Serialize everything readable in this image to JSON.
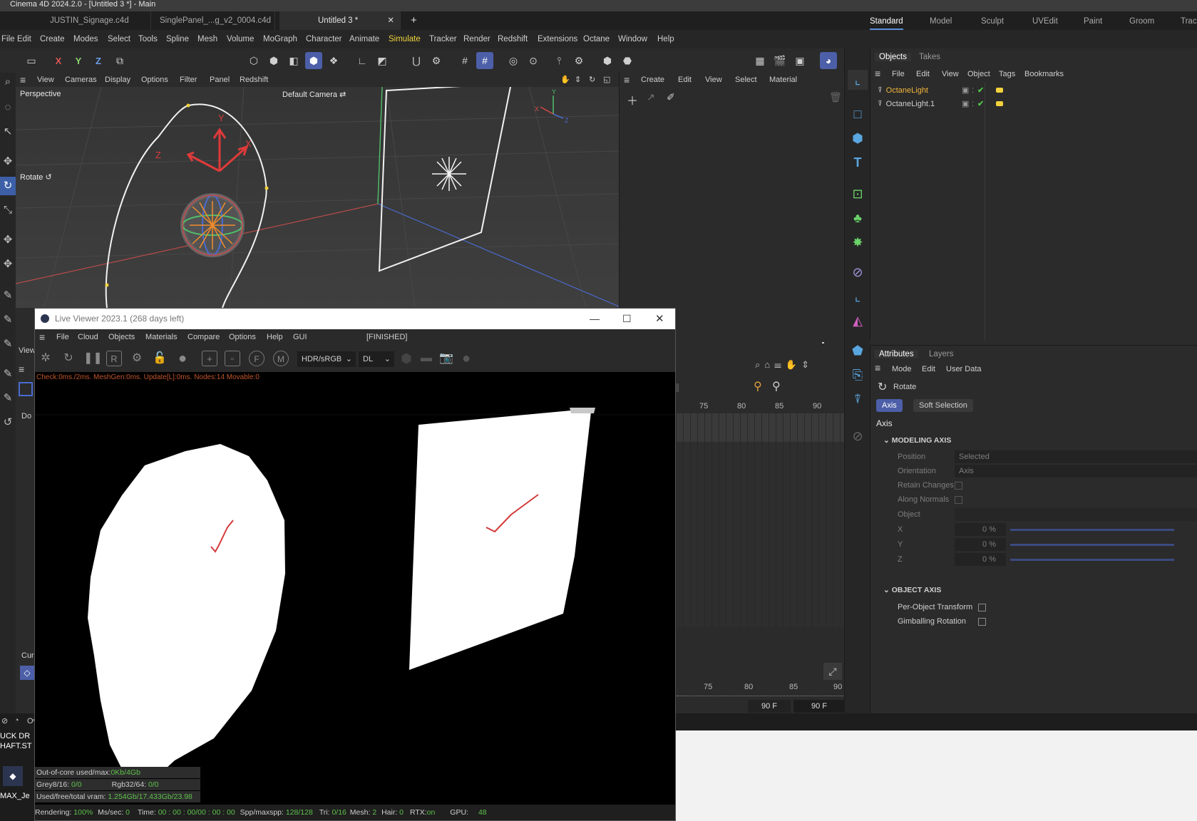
{
  "window": {
    "title": "Cinema 4D 2024.2.0 - [Untitled 3 *] - Main"
  },
  "doc_tabs": [
    "JUSTIN_Signage.c4d",
    "SinglePanel_...g_v2_0004.c4d",
    "Untitled 3 *"
  ],
  "layouts": [
    "Standard",
    "Model",
    "Sculpt",
    "UVEdit",
    "Paint",
    "Groom",
    "Track"
  ],
  "menu": [
    "File",
    "Edit",
    "Create",
    "Modes",
    "Select",
    "Tools",
    "Spline",
    "Mesh",
    "Volume",
    "MoGraph",
    "Character",
    "Animate",
    "Simulate",
    "Tracker",
    "Render",
    "Redshift",
    "Extensions",
    "Octane",
    "Window",
    "Help"
  ],
  "toolbar": {
    "axis_x": "X",
    "axis_y": "Y",
    "axis_z": "Z"
  },
  "viewport": {
    "menu": [
      "View",
      "Cameras",
      "Display",
      "Options",
      "Filter",
      "Panel",
      "Redshift"
    ],
    "label": "Perspective",
    "camera": "Default Camera",
    "tool": "Rotate",
    "axis_letters": {
      "x": "X",
      "y": "Y",
      "z": "Z"
    },
    "gizmo_letters": {
      "y": "Y",
      "x": "X",
      "z": "Z"
    }
  },
  "materials": {
    "menu": [
      "Create",
      "Edit",
      "View",
      "Select",
      "Material"
    ]
  },
  "objects_panel": {
    "tabs": [
      "Objects",
      "Takes"
    ],
    "menu": [
      "File",
      "Edit",
      "View",
      "Object",
      "Tags",
      "Bookmarks"
    ],
    "items": [
      {
        "name": "OctaneLight",
        "selected": true
      },
      {
        "name": "OctaneLight.1",
        "selected": false
      }
    ]
  },
  "attributes": {
    "tabs": [
      "Attributes",
      "Layers"
    ],
    "menu": [
      "Mode",
      "Edit",
      "User Data"
    ],
    "tool": "Rotate",
    "chips": [
      "Axis",
      "Soft Selection"
    ],
    "heading": "Axis",
    "section1": "MODELING AXIS",
    "position_label": "Position",
    "position_value": "Selected",
    "orientation_label": "Orientation",
    "orientation_value": "Axis",
    "retain": "Retain Changes",
    "along": "Along Normals",
    "object": "Object",
    "x_label": "X",
    "x_value": "0 %",
    "y_label": "Y",
    "y_value": "0 %",
    "z_label": "Z",
    "z_value": "0 %",
    "section2": "OBJECT AXIS",
    "per_object": "Per-Object Transform",
    "gimbal": "Gimballing Rotation"
  },
  "timeline": {
    "frames_top": [
      "75",
      "80",
      "85",
      "90"
    ],
    "frames_bottom": [
      "75",
      "80",
      "85",
      "90"
    ],
    "end_a": "90 F",
    "end_b": "90 F"
  },
  "left_panel": {
    "view_stub": "View",
    "doc_stub": "Do",
    "cur_stub": "Cur",
    "console_stub": "Ov",
    "text_a": "UCK DR",
    "text_b": "HAFT.ST",
    "text_c": "MAX_Je"
  },
  "live_viewer": {
    "title": "Live Viewer 2023.1 (268 days left)",
    "menu": [
      "File",
      "Cloud",
      "Objects",
      "Materials",
      "Compare",
      "Options",
      "Help",
      "GUI"
    ],
    "state": "[FINISHED]",
    "colorspace": "HDR/sRGB",
    "kernel": "DL",
    "stats": "Check:0ms./2ms. MeshGen:0ms. Update[L]:0ms. Nodes:14 Movable:0",
    "ooc_label": "Out-of-core used/max:",
    "ooc_value": "0Kb/4Gb",
    "grey_label": "Grey8/16: ",
    "grey_value": "0/0",
    "rgb_label": "Rgb32/64: ",
    "rgb_value": "0/0",
    "vram_label": "Used/free/total vram: ",
    "vram_value": "1.254Gb/17.433Gb/23.98",
    "status": {
      "rendering_label": "Rendering: ",
      "rendering_value": "100%",
      "ms_label": "Ms/sec: ",
      "ms_value": "0",
      "time_label": "Time: ",
      "time_value": "00 : 00 : 00/00 : 00 : 00",
      "spp_label": "Spp/maxspp: ",
      "spp_value": "128/128",
      "tri_label": "Tri: ",
      "tri_value": "0/16",
      "mesh_label": "Mesh: ",
      "mesh_value": "2",
      "hair_label": "Hair: ",
      "hair_value": "0",
      "rtx_label": "RTX:",
      "rtx_value": "on",
      "gpu_label": "GPU:",
      "gpu_value": "48"
    }
  },
  "colors": {
    "accent": "#4c5fa8",
    "highlight": "#f2d23c",
    "active_object": "#f2b63c",
    "check": "#4fc14b"
  }
}
